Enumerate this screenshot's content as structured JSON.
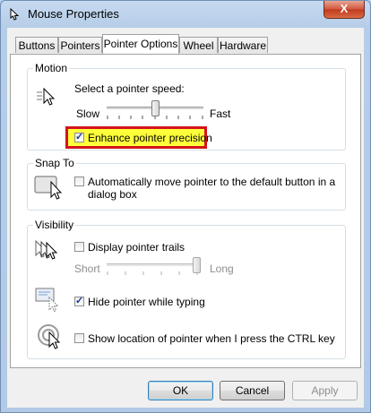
{
  "window": {
    "title": "Mouse Properties",
    "close_label": "X"
  },
  "tabs": [
    {
      "label": "Buttons"
    },
    {
      "label": "Pointers"
    },
    {
      "label": "Pointer Options",
      "active": true
    },
    {
      "label": "Wheel"
    },
    {
      "label": "Hardware"
    }
  ],
  "motion": {
    "group_label": "Motion",
    "speed_label": "Select a pointer speed:",
    "slow_label": "Slow",
    "fast_label": "Fast",
    "speed_value": 0.5,
    "precision_label": "Enhance pointer precision",
    "precision_checked": true
  },
  "snap": {
    "group_label": "Snap To",
    "option_label_line1": "Automatically move pointer to the default button in a",
    "option_label_line2": "dialog box",
    "checked": false
  },
  "visibility": {
    "group_label": "Visibility",
    "trails_label": "Display pointer trails",
    "trails_checked": false,
    "short_label": "Short",
    "long_label": "Long",
    "trail_length_value": 1.0,
    "hide_label": "Hide pointer while typing",
    "hide_checked": true,
    "ctrl_label": "Show location of pointer when I press the CTRL key",
    "ctrl_checked": false
  },
  "buttons": {
    "ok": "OK",
    "cancel": "Cancel",
    "apply": "Apply"
  },
  "colors": {
    "highlight": "#ffff3a",
    "highlight_border": "#d4141c"
  },
  "icons": {
    "title": "mouse-icon",
    "check": "checkmark-icon",
    "close": "close-icon"
  }
}
